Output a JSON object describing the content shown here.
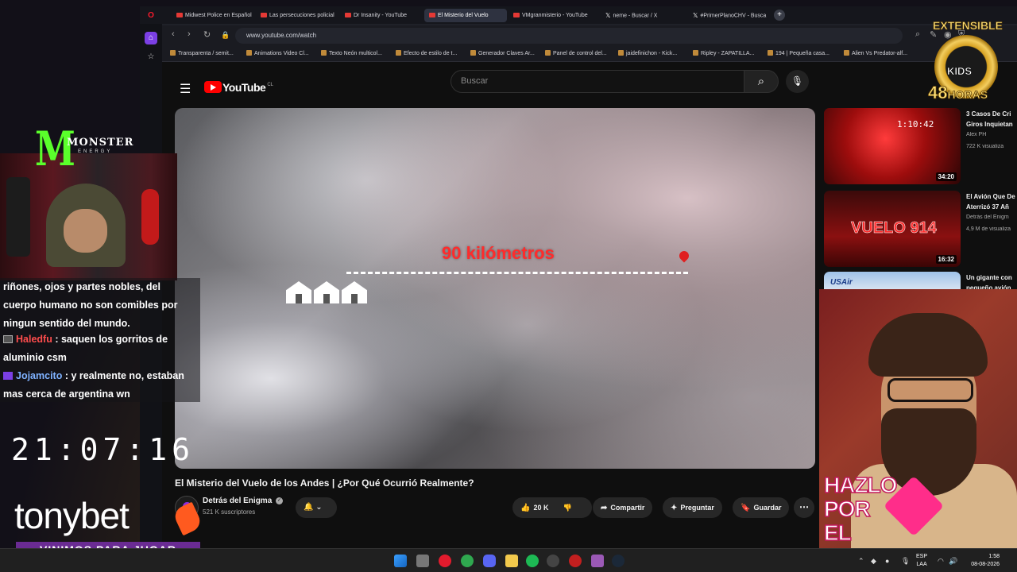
{
  "browser": {
    "tabs": [
      {
        "label": "Midwest Police en Español"
      },
      {
        "label": "Las persecuciones policial"
      },
      {
        "label": "Dr Insanity - YouTube"
      },
      {
        "label": "El Misterio del Vuelo"
      },
      {
        "label": "VMgranmisterio - YouTube"
      },
      {
        "label": "neme - Buscar / X"
      },
      {
        "label": "#PrimerPlanoCHV - Busca"
      }
    ],
    "new_tab": "+",
    "url": "www.youtube.com/watch",
    "bookmarks": [
      "Transparenta / semit...",
      "Animations Video Cl...",
      "Texto Neón multicol...",
      "Efecto de estilo de t...",
      "Generador Claves Ar...",
      "Panel de control del...",
      "jaidefinichon - Kick...",
      "Ripley - ZAPATILLA...",
      "194 | Pequeña casa...",
      "Alien Vs Predator-alf..."
    ]
  },
  "youtube": {
    "logo_text": "YouTube",
    "logo_region": "CL",
    "search_placeholder": "Buscar",
    "video": {
      "overlay_text": "90 kilómetros",
      "title": "El Misterio del Vuelo de los Andes | ¿Por Qué Ocurrió Realmente?"
    },
    "channel": {
      "name": "Detrás del Enigma",
      "subscribers": "521 K suscriptores"
    },
    "actions": {
      "likes": "20 K",
      "share": "Compartir",
      "ask": "Preguntar",
      "save": "Guardar"
    },
    "related": [
      {
        "title": "3 Casos De Cri",
        "title2": "Giros Inquietan",
        "channel": "Alex PH",
        "views": "722 K visualiza",
        "duration": "34:20",
        "overlay": "1:10:42"
      },
      {
        "title": "El Avión Que De",
        "title2": "Aterrizó 37 Añ",
        "channel": "Detrás del Enigm",
        "views": "4,9 M de visualiza",
        "duration": "16:32",
        "overlay": "VUELO 914"
      },
      {
        "title": "Un gigante con",
        "title2": "pequeño avión",
        "overlay": "USAir"
      }
    ]
  },
  "stream": {
    "sponsor_brand": "MONSTER",
    "sponsor_sub": "ENERGY",
    "chat": [
      {
        "user": "",
        "message": "riñones, ojos y partes nobles, del cuerpo humano no son comibles por ningun sentido del mundo."
      },
      {
        "user": "Haledfu",
        "message": ": saquen los gorritos de aluminio csm",
        "color": "#ff4d4d"
      },
      {
        "user": "Jojamcito",
        "message": ": y realmente no, estaban mas cerca de argentina wn",
        "color": "#7fb2ff"
      }
    ],
    "clock": "21:07:16",
    "casino_brand": "tonybet",
    "slogan": "VINIMOS PARA JUGAR",
    "promo_text_line1": "HAZLO",
    "promo_text_line2": "POR",
    "promo_text_line3": "EL",
    "event_top": "EXTENSIBLE",
    "event_kids": "KIDS",
    "event_hours_num": "48",
    "event_hours_word": "HORAS"
  },
  "taskbar": {
    "lang_line1": "ESP",
    "lang_line2": "LAA",
    "time": "1:58",
    "date": "08-08-2026"
  },
  "colors": {
    "youtube_red": "#ff0000",
    "overlay_red": "#ff2b2b",
    "slogan_bg": "#6a2b93"
  }
}
